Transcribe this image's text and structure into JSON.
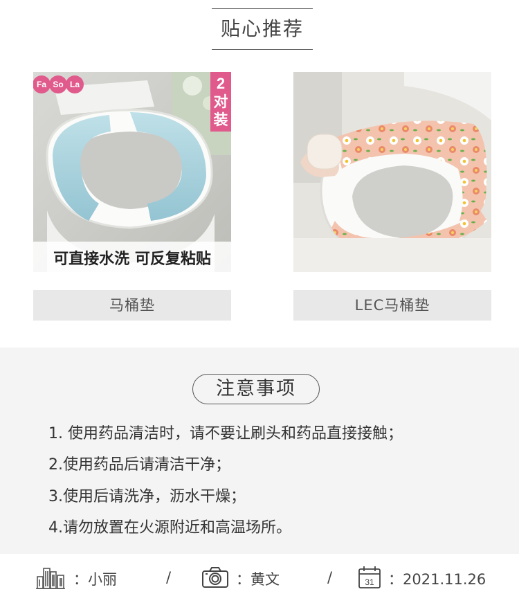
{
  "recommend": {
    "title": "贴心推荐"
  },
  "products": [
    {
      "label": "马桶垫",
      "image_text": {
        "brand_fa": "Fa",
        "brand_so": "So",
        "brand_la": "La",
        "badge_num": "2",
        "badge_c1": "对",
        "badge_c2": "装",
        "caption": "可直接水洗  可反复粘贴"
      }
    },
    {
      "label": "LEC马桶垫"
    }
  ],
  "notes": {
    "title": "注意事项",
    "items": [
      "1. 使用药品清洁时，请不要让刷头和药品直接接触；",
      "2.使用药品后请清洁干净；",
      "3.使用后请洗净，沥水干燥；",
      "4.请勿放置在火源附近和高温场所。"
    ]
  },
  "footer": {
    "designer_label": "：小丽",
    "photographer_label": "：黄文",
    "date_label": "：2021.11.26",
    "calendar_day": "31",
    "separator": "/",
    "icons": [
      "buildings-icon",
      "camera-icon",
      "calendar-icon"
    ]
  },
  "colors": {
    "brand_pink": "#e05a8c",
    "notes_bg": "#f4f4f4",
    "label_bg": "#e8e8e8"
  }
}
